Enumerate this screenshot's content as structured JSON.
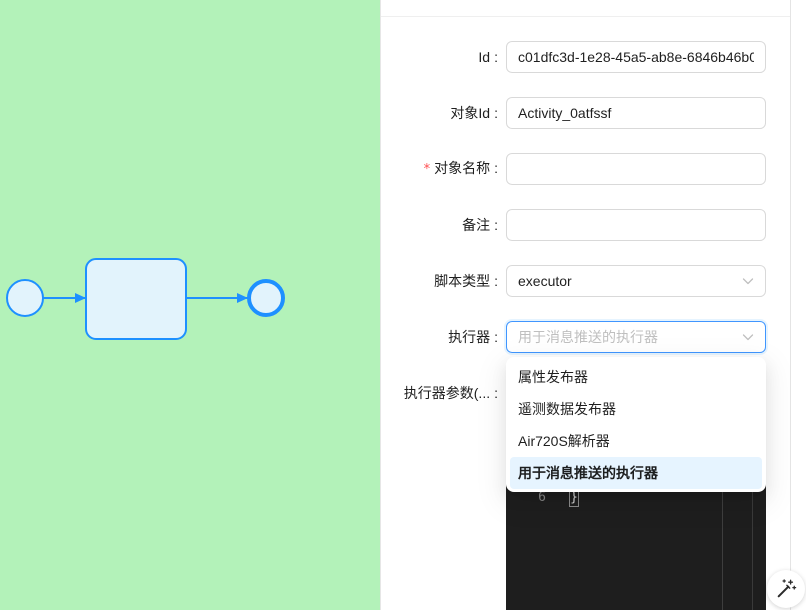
{
  "colors": {
    "canvas_bg": "#b3f2b9",
    "shape_stroke": "#1e90ff",
    "shape_fill": "#e2f3fc",
    "accent": "#4096ff",
    "selected_option_bg": "#e6f4ff",
    "required_mark": "#ff4d4f",
    "editor_bg": "#1e1e1e"
  },
  "form": {
    "colon": ":",
    "required_mark": "*",
    "fields": [
      {
        "label": "Id",
        "value": "c01dfc3d-1e28-45a5-ab8e-6846b46b0"
      },
      {
        "label": "对象Id",
        "value": "Activity_0atfssf"
      },
      {
        "label": "对象名称",
        "value": "",
        "required": true
      },
      {
        "label": "备注",
        "value": ""
      },
      {
        "label": "脚本类型",
        "value": "executor"
      },
      {
        "label": "执行器",
        "value": "用于消息推送的执行器",
        "focused": true,
        "open": true
      },
      {
        "label": "执行器参数(..."
      }
    ]
  },
  "dropdown": {
    "options": [
      "属性发布器",
      "遥测数据发布器",
      "Air720S解析器",
      "用于消息推送的执行器"
    ],
    "selected_index": 3
  },
  "editor": {
    "line_number": "6",
    "line_text": "}"
  },
  "icons": {
    "select_arrow": "chevron-down-icon",
    "floating_button": "magic-wand-icon"
  }
}
